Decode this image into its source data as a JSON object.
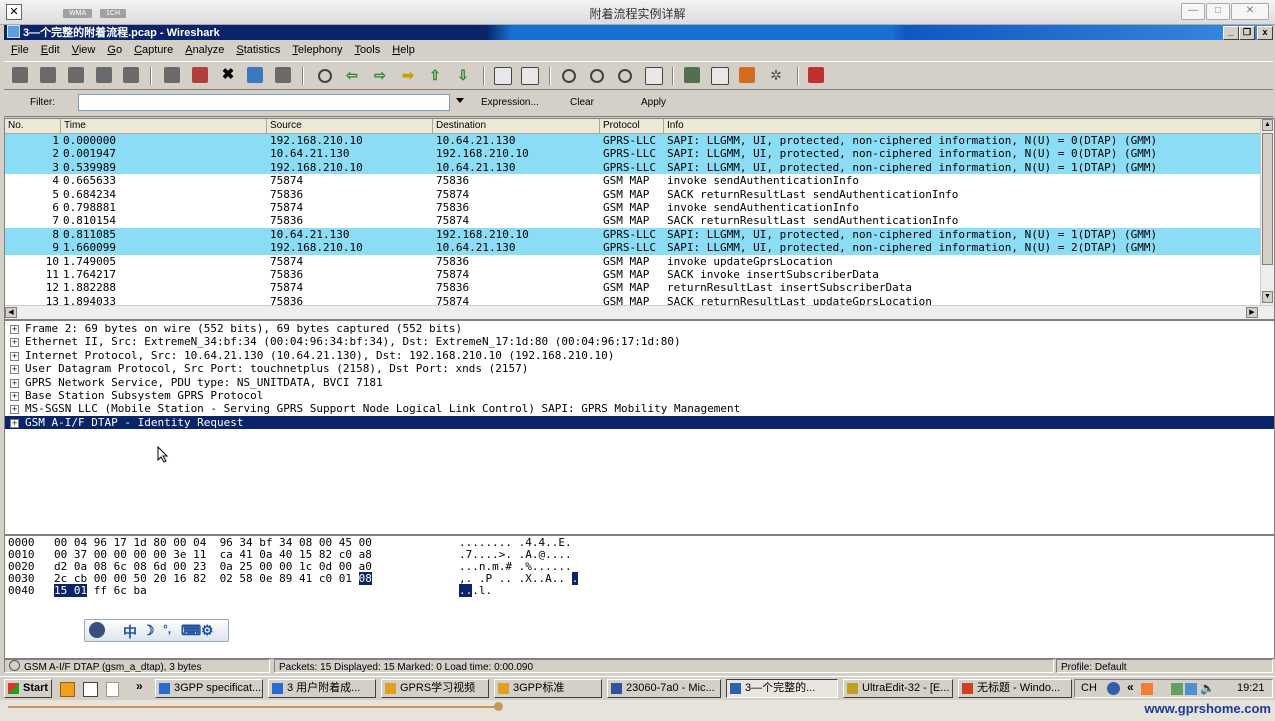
{
  "outer": {
    "title": "附着流程实例详解",
    "tags": [
      "WMA",
      "1CH"
    ]
  },
  "window": {
    "title": "3—个完整的附着流程.pcap - Wireshark"
  },
  "menu": [
    "File",
    "Edit",
    "View",
    "Go",
    "Capture",
    "Analyze",
    "Statistics",
    "Telephony",
    "Tools",
    "Help"
  ],
  "filter": {
    "label": "Filter:",
    "value": "",
    "expression": "Expression...",
    "clear": "Clear",
    "apply": "Apply"
  },
  "columns": [
    "No.",
    "Time",
    "Source",
    "Destination",
    "Protocol",
    "Info"
  ],
  "packets": [
    {
      "no": "1",
      "time": "0.000000",
      "src": "192.168.210.10",
      "dst": "10.64.21.130",
      "proto": "GPRS-LLC",
      "info": "SAPI: LLGMM, UI, protected, non-ciphered information, N(U) = 0(DTAP) (GMM)",
      "llc": true
    },
    {
      "no": "2",
      "time": "0.001947",
      "src": "10.64.21.130",
      "dst": "192.168.210.10",
      "proto": "GPRS-LLC",
      "info": "SAPI: LLGMM, UI, protected, non-ciphered information, N(U) = 0(DTAP) (GMM)",
      "llc": true
    },
    {
      "no": "3",
      "time": "0.539989",
      "src": "192.168.210.10",
      "dst": "10.64.21.130",
      "proto": "GPRS-LLC",
      "info": "SAPI: LLGMM, UI, protected, non-ciphered information, N(U) = 1(DTAP) (GMM)",
      "llc": true
    },
    {
      "no": "4",
      "time": "0.665633",
      "src": "75874",
      "dst": "75836",
      "proto": "GSM MAP",
      "info": "invoke sendAuthenticationInfo",
      "llc": false
    },
    {
      "no": "5",
      "time": "0.684234",
      "src": "75836",
      "dst": "75874",
      "proto": "GSM MAP",
      "info": "SACK returnResultLast sendAuthenticationInfo",
      "llc": false
    },
    {
      "no": "6",
      "time": "0.798881",
      "src": "75874",
      "dst": "75836",
      "proto": "GSM MAP",
      "info": "invoke sendAuthenticationInfo",
      "llc": false
    },
    {
      "no": "7",
      "time": "0.810154",
      "src": "75836",
      "dst": "75874",
      "proto": "GSM MAP",
      "info": "SACK returnResultLast sendAuthenticationInfo",
      "llc": false
    },
    {
      "no": "8",
      "time": "0.811085",
      "src": "10.64.21.130",
      "dst": "192.168.210.10",
      "proto": "GPRS-LLC",
      "info": "SAPI: LLGMM, UI, protected, non-ciphered information, N(U) = 1(DTAP) (GMM)",
      "llc": true
    },
    {
      "no": "9",
      "time": "1.660099",
      "src": "192.168.210.10",
      "dst": "10.64.21.130",
      "proto": "GPRS-LLC",
      "info": "SAPI: LLGMM, UI, protected, non-ciphered information, N(U) = 2(DTAP) (GMM)",
      "llc": true
    },
    {
      "no": "10",
      "time": "1.749005",
      "src": "75874",
      "dst": "75836",
      "proto": "GSM MAP",
      "info": "invoke updateGprsLocation",
      "llc": false
    },
    {
      "no": "11",
      "time": "1.764217",
      "src": "75836",
      "dst": "75874",
      "proto": "GSM MAP",
      "info": "SACK invoke insertSubscriberData",
      "llc": false
    },
    {
      "no": "12",
      "time": "1.882288",
      "src": "75874",
      "dst": "75836",
      "proto": "GSM MAP",
      "info": "returnResultLast insertSubscriberData",
      "llc": false
    },
    {
      "no": "13",
      "time": "1.894033",
      "src": "75836",
      "dst": "75874",
      "proto": "GSM MAP",
      "info": "SACK returnResultLast updateGprsLocation",
      "llc": false
    }
  ],
  "details": [
    {
      "text": "Frame 2: 69 bytes on wire (552 bits), 69 bytes captured (552 bits)",
      "selected": false
    },
    {
      "text": "Ethernet II, Src: ExtremeN_34:bf:34 (00:04:96:34:bf:34), Dst: ExtremeN_17:1d:80 (00:04:96:17:1d:80)",
      "selected": false
    },
    {
      "text": "Internet Protocol, Src: 10.64.21.130 (10.64.21.130), Dst: 192.168.210.10 (192.168.210.10)",
      "selected": false
    },
    {
      "text": "User Datagram Protocol, Src Port: touchnetplus (2158), Dst Port: xnds (2157)",
      "selected": false
    },
    {
      "text": "GPRS Network Service, PDU type: NS_UNITDATA, BVCI 7181",
      "selected": false
    },
    {
      "text": "Base Station Subsystem GPRS Protocol",
      "selected": false
    },
    {
      "text": "MS-SGSN LLC (Mobile Station - Serving GPRS Support Node Logical Link Control)  SAPI: GPRS Mobility Management",
      "selected": false
    },
    {
      "text": "GSM A-I/F DTAP - Identity Request",
      "selected": true
    }
  ],
  "hex": [
    {
      "off": "0000",
      "bytes": "00 04 96 17 1d 80 00 04  96 34 bf 34 08 00 45 00",
      "ascii": "........ .4.4..E."
    },
    {
      "off": "0010",
      "bytes": "00 37 00 00 00 00 3e 11  ca 41 0a 40 15 82 c0 a8",
      "ascii": ".7....>. .A.@...."
    },
    {
      "off": "0020",
      "bytes": "d2 0a 08 6c 08 6d 00 23  0a 25 00 00 1c 0d 00 a0",
      "ascii": "...n.m.# .%......"
    },
    {
      "off": "0030",
      "bytes": "2c cb 00 00 50 20 16 82  02 58 0e 89 41 c0 01",
      "hlbytes": "08",
      "ascii": ",. .P .. .X..A..",
      "hlascii": "."
    },
    {
      "off": "0040",
      "hlbytes": "15 01",
      "bytes": "ff 6c ba",
      "hlascii": "..",
      "ascii": ".l."
    }
  ],
  "status": {
    "field": "GSM A-I/F DTAP (gsm_a_dtap), 3 bytes",
    "packets": "Packets: 15 Displayed: 15 Marked: 0 Load time: 0:00.090",
    "profile": "Profile: Default"
  },
  "taskbar": {
    "start": "Start",
    "items": [
      {
        "label": "3GPP specificat...",
        "active": false
      },
      {
        "label": "3 用户附着成...",
        "active": false
      },
      {
        "label": "GPRS学习视频",
        "active": false
      },
      {
        "label": "3GPP标准",
        "active": false
      },
      {
        "label": "23060-7a0 - Mic...",
        "active": false
      },
      {
        "label": "3—个完整的...",
        "active": true
      },
      {
        "label": "UltraEdit-32 - [E...",
        "active": false
      },
      {
        "label": "无标题 - Windo...",
        "active": false
      }
    ],
    "lang": "CH",
    "clock": "19:21"
  },
  "watermark": "www.gprshome.com"
}
